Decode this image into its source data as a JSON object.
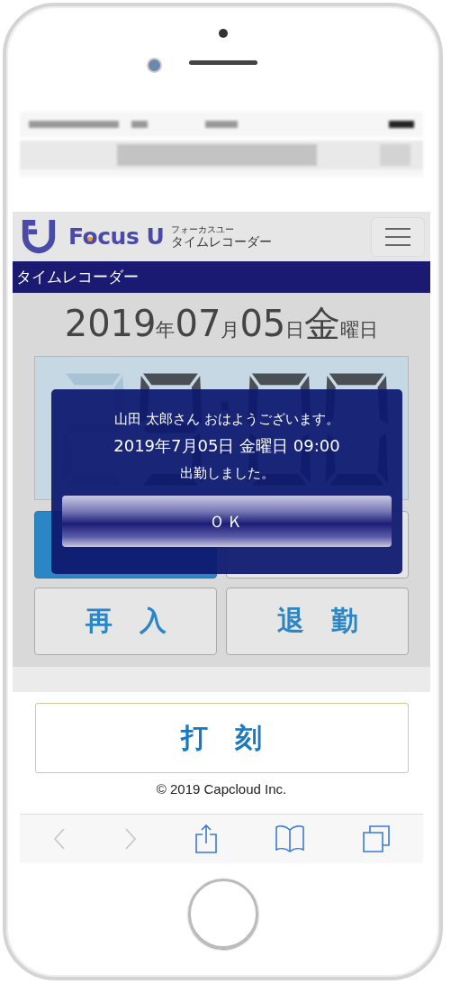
{
  "brand": {
    "name": "Focus U",
    "ruby": "フォーカスユー",
    "subtitle": "タイムレコーダー"
  },
  "page_title": "タイムレコーダー",
  "date_heading": [
    {
      "text": "2019",
      "kind": "big"
    },
    {
      "text": "年",
      "kind": "small"
    },
    {
      "text": "07",
      "kind": "big"
    },
    {
      "text": "月",
      "kind": "small"
    },
    {
      "text": "05",
      "kind": "big"
    },
    {
      "text": "日",
      "kind": "small"
    },
    {
      "text": "金",
      "kind": "big"
    },
    {
      "text": "曜日",
      "kind": "small"
    }
  ],
  "punch_buttons": [
    {
      "selected": true
    },
    {
      "selected": false
    },
    {
      "label": "再　入",
      "selected": false
    },
    {
      "label": "退　勤",
      "selected": false
    }
  ],
  "dialog": {
    "lines": [
      "山田 太郎さん おはようございます。",
      "2019年7月05日 金曜日 09:00",
      "出勤しました。"
    ],
    "button": "ＯＫ"
  },
  "stamp_button": "打　刻",
  "footer": "© 2019 Capcloud Inc."
}
